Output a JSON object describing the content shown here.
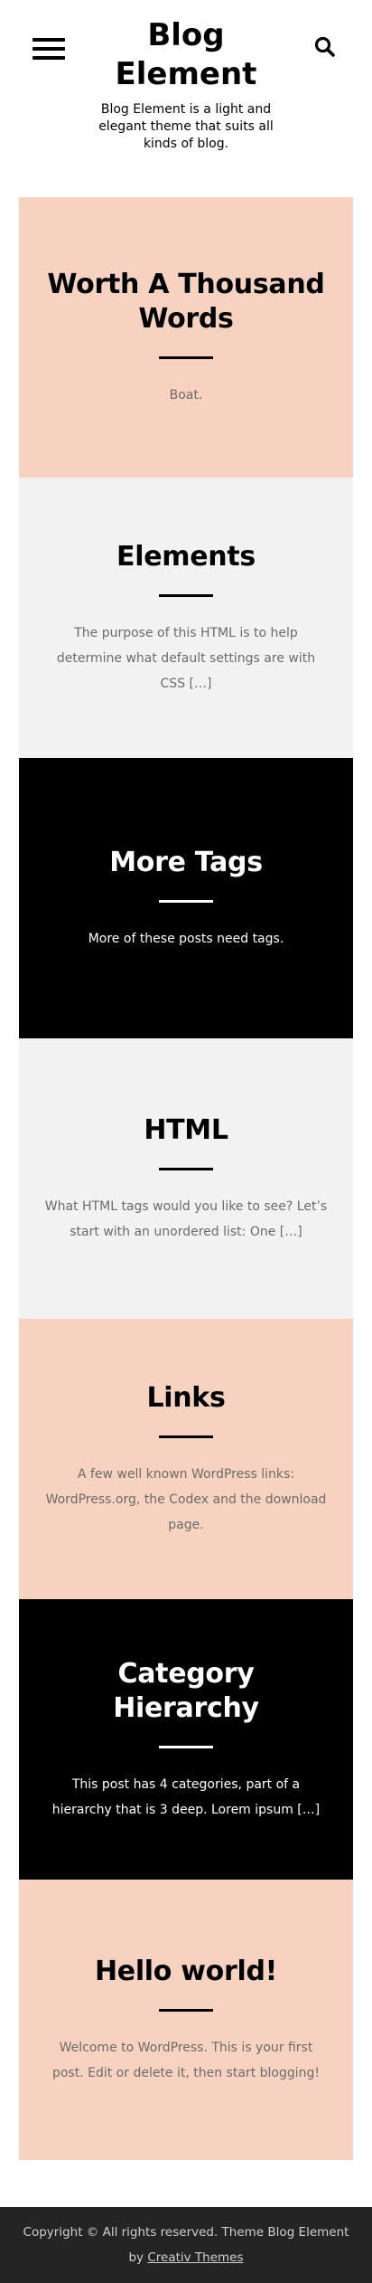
{
  "header": {
    "menu_icon": "hamburger-menu-icon",
    "search_icon": "search-icon",
    "site_title": "Blog Element",
    "site_description": "Blog Element is a light and elegant theme that suits all kinds of blog."
  },
  "posts": [
    {
      "title": "Worth A Thousand Words",
      "excerpt": "Boat.",
      "bg": "#f8d2c0"
    },
    {
      "title": "Elements",
      "excerpt": "The purpose of this HTML is to help determine what default settings are with CSS […]",
      "bg": "#f2f2f2"
    },
    {
      "title": "More Tags",
      "excerpt": "More of these posts need tags.",
      "bg": "#000000"
    },
    {
      "title": "HTML",
      "excerpt": "What HTML tags would you like to see? Let’s start with an unordered list: One […]",
      "bg": "#f2f2f2"
    },
    {
      "title": "Links",
      "excerpt": "A few well known WordPress links: WordPress.org, the Codex and the download page.",
      "bg": "#f8d2c0"
    },
    {
      "title": "Category Hierarchy",
      "excerpt": "This post has 4 categories, part of a hierarchy that is 3 deep. Lorem ipsum […]",
      "bg": "#000000"
    },
    {
      "title": "Hello world!",
      "excerpt": "Welcome to WordPress. This is your first post. Edit or delete it, then start blogging!",
      "bg": "#f8d2c0"
    }
  ],
  "footer": {
    "copyright": "Copyright © All rights reserved. Theme Blog Element",
    "by_prefix": "by ",
    "credit_link": "Creativ Themes"
  }
}
